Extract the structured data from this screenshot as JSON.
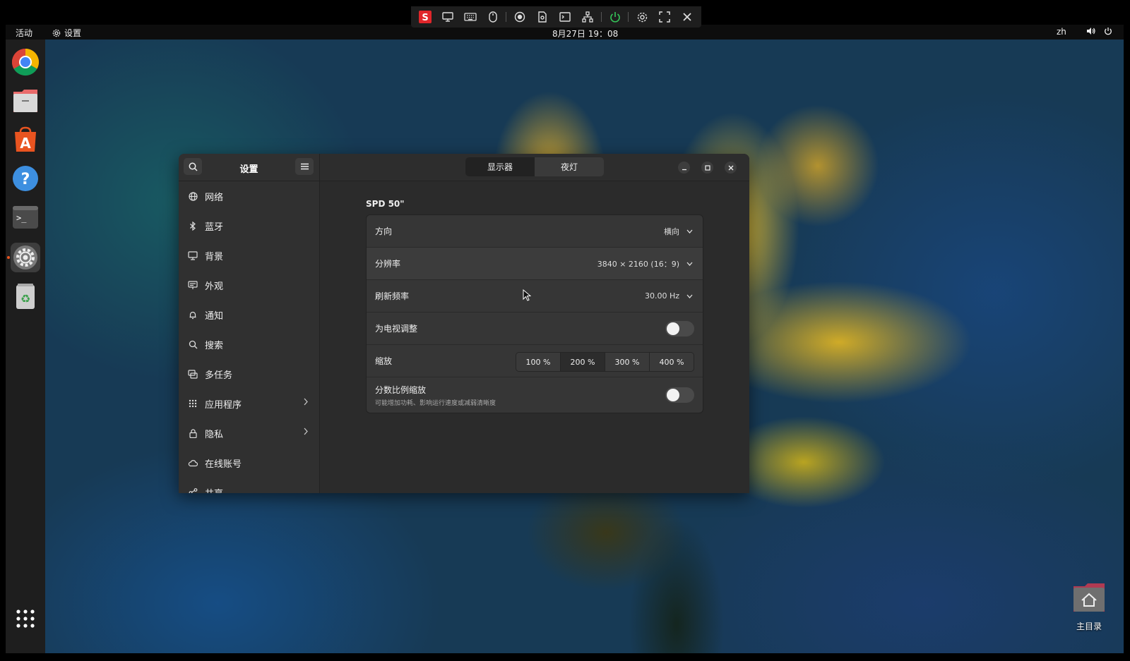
{
  "remote_toolbar": {
    "icons": [
      "s-logo-icon",
      "monitor-icon",
      "keyboard-icon",
      "mouse-icon",
      "record-icon",
      "file-icon",
      "terminal-icon",
      "network-icon",
      "power-icon",
      "gear-icon",
      "fullscreen-icon",
      "close-icon"
    ]
  },
  "topbar": {
    "activities": "活动",
    "app_name": "设置",
    "clock": "8月27日  19：08",
    "lang": "zh"
  },
  "dock": {
    "apps": [
      "chrome-icon",
      "files-icon",
      "app-store-icon",
      "help-icon",
      "terminal-icon",
      "settings-icon",
      "trash-icon"
    ],
    "show_apps": "show-apps-icon"
  },
  "desktop": {
    "home_label": "主目录"
  },
  "settings": {
    "title": "设置",
    "sidebar": [
      {
        "label": "网络",
        "icon": "network-icon",
        "chevron": false
      },
      {
        "label": "蓝牙",
        "icon": "bluetooth-icon",
        "chevron": false
      },
      {
        "label": "背景",
        "icon": "background-icon",
        "chevron": false
      },
      {
        "label": "外观",
        "icon": "appearance-icon",
        "chevron": false
      },
      {
        "label": "通知",
        "icon": "bell-icon",
        "chevron": false
      },
      {
        "label": "搜索",
        "icon": "search-icon",
        "chevron": false
      },
      {
        "label": "多任务",
        "icon": "multitask-icon",
        "chevron": false
      },
      {
        "label": "应用程序",
        "icon": "apps-grid-icon",
        "chevron": true
      },
      {
        "label": "隐私",
        "icon": "lock-icon",
        "chevron": true
      },
      {
        "label": "在线账号",
        "icon": "cloud-icon",
        "chevron": false
      },
      {
        "label": "共享",
        "icon": "share-icon",
        "chevron": false
      }
    ],
    "tabs": [
      {
        "label": "显示器",
        "selected": true
      },
      {
        "label": "夜灯",
        "selected": false
      }
    ],
    "monitor": "SPD 50\"",
    "rows": {
      "orientation": {
        "label": "方向",
        "value": "横向"
      },
      "resolution": {
        "label": "分辨率",
        "value": "3840 × 2160 (16：9)"
      },
      "refresh": {
        "label": "刷新频率",
        "value": "30.00 Hz"
      },
      "tv_adjust": {
        "label": "为电视调整",
        "enabled": false
      },
      "scale": {
        "label": "缩放",
        "options": [
          "100 %",
          "200 %",
          "300 %",
          "400 %"
        ],
        "selected": "200 %"
      },
      "fractional": {
        "label": "分数比例缩放",
        "sublabel": "可能增加功耗、影响运行速度或减弱清晰度",
        "enabled": false
      }
    }
  }
}
